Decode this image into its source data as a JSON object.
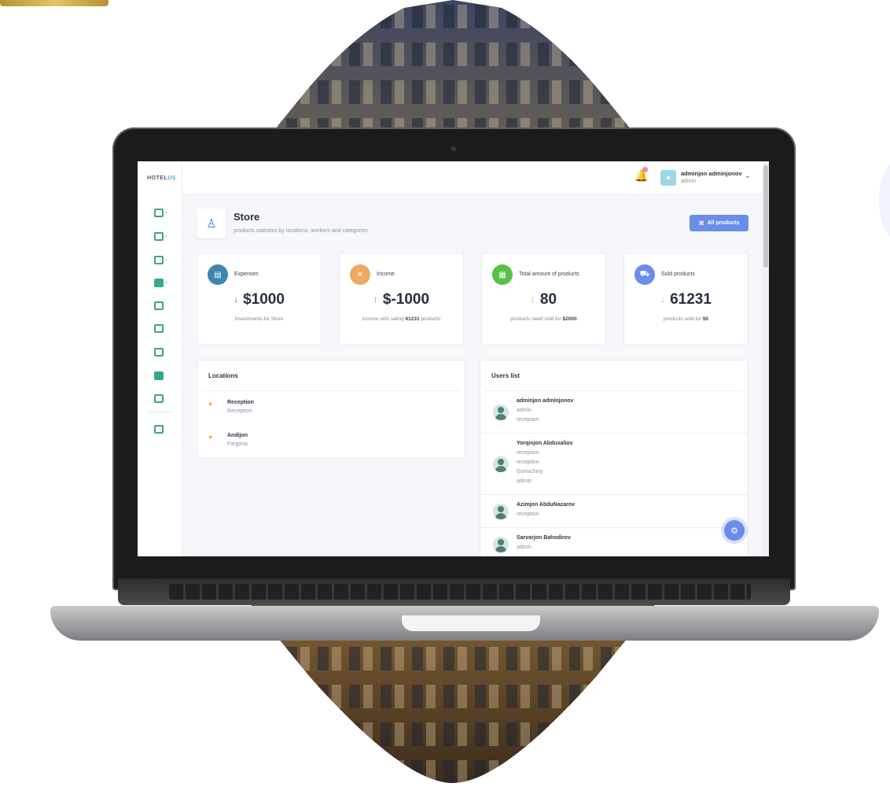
{
  "app": {
    "brand_prefix": "HOTEL",
    "brand_suffix": "US"
  },
  "sidebar": {
    "items": [
      {
        "icon": "dashboard-icon",
        "color": "#3aa58c",
        "has_caret": true
      },
      {
        "icon": "bed-icon",
        "color": "#3aa58c",
        "has_caret": true
      },
      {
        "icon": "grid-icon",
        "color": "#3aa58c",
        "has_caret": true
      },
      {
        "icon": "inbox-icon",
        "color": "#3aa58c",
        "has_caret": true
      },
      {
        "icon": "document-icon",
        "color": "#3aa58c",
        "has_caret": false
      },
      {
        "icon": "bell-icon",
        "color": "#3aa58c",
        "has_caret": false
      },
      {
        "icon": "wallet-icon",
        "color": "#3aa58c",
        "has_caret": false
      },
      {
        "icon": "table-icon",
        "color": "#3aa58c",
        "has_caret": false
      },
      {
        "icon": "archive-icon",
        "color": "#3aa58c",
        "has_caret": false
      },
      {
        "icon": "hierarchy-icon",
        "color": "#3aa58c",
        "has_caret": false
      }
    ],
    "caret": "›"
  },
  "header": {
    "user_name": "adminjon adminjonov",
    "user_role": "admin",
    "chevron": "⌄",
    "bell": "🔔"
  },
  "page": {
    "title": "Store",
    "subtitle": "products statistics by locations, workers and categories",
    "all_products_label": "All products"
  },
  "cards": [
    {
      "label": "Expenses",
      "value": "$1000",
      "arrow": "↓",
      "arrow_color": "#e0344f",
      "icon_color": "#3e86b0",
      "note_prefix": "Investments for Store",
      "note_bold": "",
      "note_suffix": ""
    },
    {
      "label": "Income",
      "value": "$-1000",
      "arrow": "↑",
      "arrow_color": "#35b36b",
      "icon_color": "#f0a963",
      "note_prefix": "income with saling ",
      "note_bold": "61231",
      "note_suffix": " products"
    },
    {
      "label": "Total amount of products",
      "value": "80",
      "arrow": "↓",
      "arrow_color": "#f2a93b",
      "icon_color": "#59bf4a",
      "note_prefix": "products need sold for ",
      "note_bold": "$2000",
      "note_suffix": ""
    },
    {
      "label": "Sold products",
      "value": "61231",
      "arrow": "↓",
      "arrow_color": "#f2a93b",
      "icon_color": "#6a8dea",
      "note_prefix": "products sold for ",
      "note_bold": "$0",
      "note_suffix": ""
    }
  ],
  "locations": {
    "title": "Locations",
    "items": [
      {
        "name": "Reception",
        "sub": "Reception"
      },
      {
        "name": "Andijon",
        "sub": "Fargona"
      }
    ]
  },
  "users": {
    "title": "Users list",
    "items": [
      {
        "name": "adminjon adminjonov",
        "roles": [
          "admin",
          "reception"
        ]
      },
      {
        "name": "Yorqinjon Abduxaliov",
        "roles": [
          "reception",
          "reception",
          "Gornichniy",
          "admin"
        ]
      },
      {
        "name": "Azimjon AbduNazarov",
        "roles": [
          "reception"
        ]
      },
      {
        "name": "Sarvarjon Bahodirov",
        "roles": [
          "admin"
        ]
      }
    ]
  },
  "colors": {
    "accent": "#6a8dea",
    "brand_teal": "#4aa9c8"
  }
}
